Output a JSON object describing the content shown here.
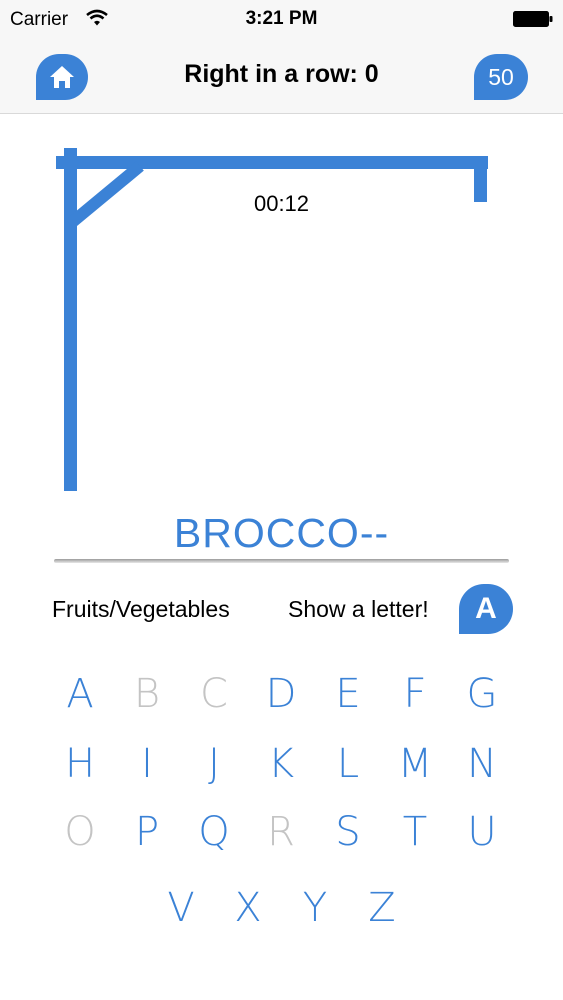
{
  "status_bar": {
    "carrier": "Carrier",
    "time": "3:21 PM"
  },
  "nav": {
    "title": "Right in a row: 0",
    "coins": "50"
  },
  "game": {
    "timer": "00:12",
    "word": "BROCCO--",
    "category": "Fruits/Vegetables",
    "hint_label": "Show a letter!",
    "hint_button": "A"
  },
  "colors": {
    "accent": "#3b82d6",
    "disabled_key": "#c4c4c4"
  },
  "keyboard": {
    "rows": [
      [
        {
          "letter": "A",
          "used": false
        },
        {
          "letter": "B",
          "used": true
        },
        {
          "letter": "C",
          "used": true
        },
        {
          "letter": "D",
          "used": false
        },
        {
          "letter": "E",
          "used": false
        },
        {
          "letter": "F",
          "used": false
        },
        {
          "letter": "G",
          "used": false
        }
      ],
      [
        {
          "letter": "H",
          "used": false
        },
        {
          "letter": "I",
          "used": false
        },
        {
          "letter": "J",
          "used": false
        },
        {
          "letter": "K",
          "used": false
        },
        {
          "letter": "L",
          "used": false
        },
        {
          "letter": "M",
          "used": false
        },
        {
          "letter": "N",
          "used": false
        }
      ],
      [
        {
          "letter": "O",
          "used": true
        },
        {
          "letter": "P",
          "used": false
        },
        {
          "letter": "Q",
          "used": false
        },
        {
          "letter": "R",
          "used": true
        },
        {
          "letter": "S",
          "used": false
        },
        {
          "letter": "T",
          "used": false
        },
        {
          "letter": "U",
          "used": false
        }
      ],
      [
        {
          "letter": "V",
          "used": false
        },
        {
          "letter": "X",
          "used": false
        },
        {
          "letter": "Y",
          "used": false
        },
        {
          "letter": "Z",
          "used": false
        }
      ]
    ]
  }
}
